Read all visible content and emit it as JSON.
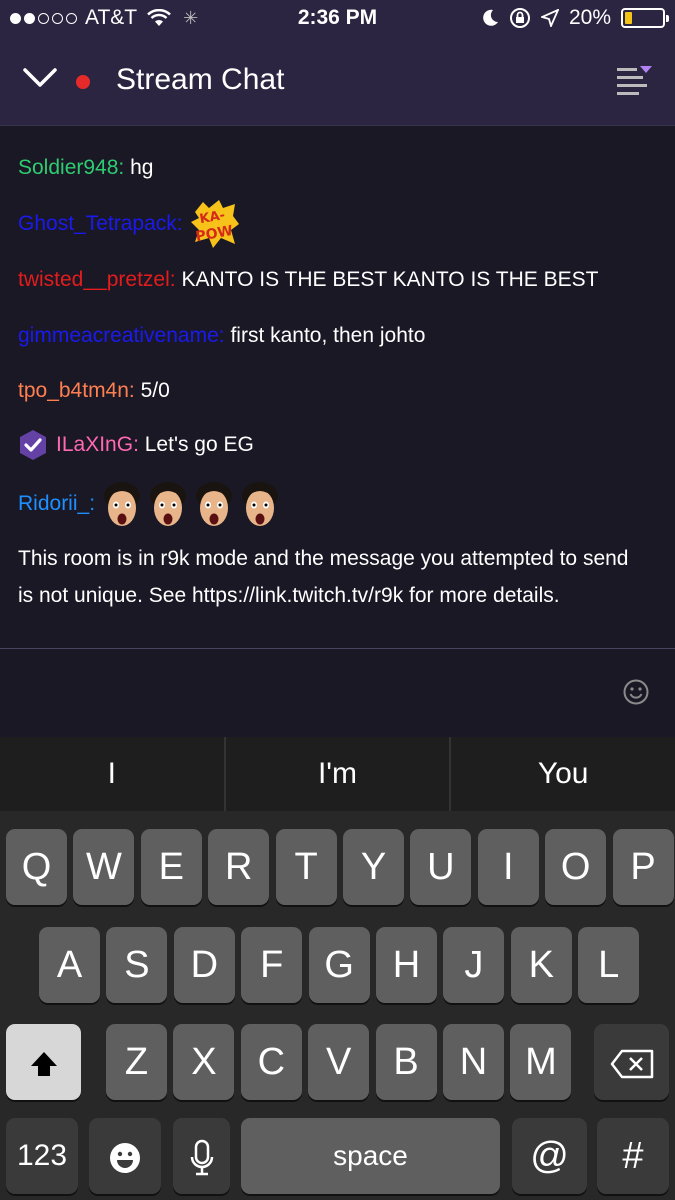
{
  "status_bar": {
    "carrier": "AT&T",
    "time": "2:36 PM",
    "battery_percent_label": "20%",
    "battery_level": 0.2,
    "signal_bars_filled": 2,
    "signal_bars_total": 5
  },
  "header": {
    "title": "Stream Chat",
    "live_color": "#e62a2a"
  },
  "chat": {
    "messages": [
      {
        "user": "Soldier948",
        "user_color": "#2ecc71",
        "text": "hg"
      },
      {
        "user": "Ghost_Tetrapack",
        "user_color": "#1a1aee",
        "text": "",
        "emote": "kapow-emote"
      },
      {
        "user": "twisted__pretzel",
        "user_color": "#e31c1c",
        "text": "KANTO IS THE BEST KANTO IS THE BEST"
      },
      {
        "user": "gimmeacreativename",
        "user_color": "#1a1aee",
        "text": "first kanto, then johto"
      },
      {
        "user": "tpo_b4tm4n",
        "user_color": "#ff7f50",
        "text": "5/0"
      },
      {
        "user": "ILaXInG",
        "user_color": "#ff69b4",
        "text": "Let's go EG",
        "badge": "verified-badge-icon"
      },
      {
        "user": "Ridorii_",
        "user_color": "#1e90ff",
        "text": "",
        "emote": "pogchamp-emote",
        "emote_count": 4
      }
    ],
    "system_message": "This room is in r9k mode and the message you attempted to send is not unique. See https://link.twitch.tv/r9k for more details."
  },
  "input": {
    "value": "",
    "emoji_icon": "smiley-icon"
  },
  "keyboard": {
    "suggestions": [
      "I",
      "I'm",
      "You"
    ],
    "row1": [
      "Q",
      "W",
      "E",
      "R",
      "T",
      "Y",
      "U",
      "I",
      "O",
      "P"
    ],
    "row2": [
      "A",
      "S",
      "D",
      "F",
      "G",
      "H",
      "J",
      "K",
      "L"
    ],
    "row3": [
      "Z",
      "X",
      "C",
      "V",
      "B",
      "N",
      "M"
    ],
    "numbers_key": "123",
    "space_key": "space",
    "at_key": "@",
    "hash_key": "#"
  },
  "colors": {
    "header_bg": "#2c2541",
    "chat_bg": "#1a1825",
    "keyboard_bg": "#282828",
    "key_bg": "#5f5f5f"
  }
}
